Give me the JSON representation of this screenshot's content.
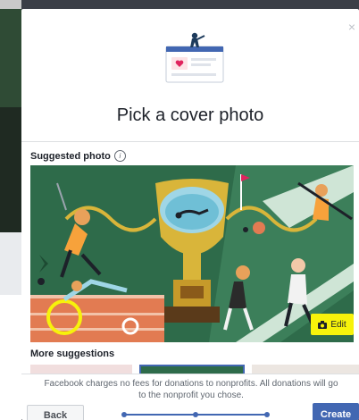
{
  "dialog": {
    "title": "Pick a cover photo",
    "close_glyph": "×",
    "hero_icon": "fundraiser-illustration"
  },
  "suggested": {
    "label": "Suggested photo",
    "info_glyph": "i",
    "edit_label": "Edit",
    "edit_icon": "camera-icon"
  },
  "more": {
    "label": "More suggestions"
  },
  "footer": {
    "notice": "Facebook charges no fees for donations to nonprofits. All donations will go to the nonprofit you chose.",
    "back_label": "Back",
    "create_label": "Create",
    "progress_steps": 3,
    "current_step": 3
  },
  "colors": {
    "primary": "#4267b2",
    "highlight": "#f7f20b",
    "illustration_green": "#2e6b4a",
    "illustration_gold": "#d9b53a"
  }
}
